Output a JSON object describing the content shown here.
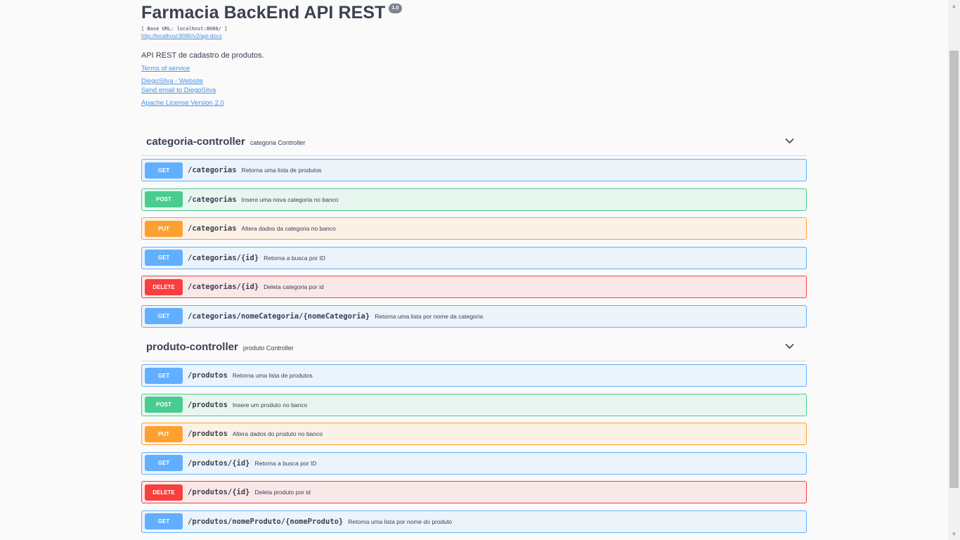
{
  "info": {
    "title": "Farmacia BackEnd API REST",
    "version": "1.0",
    "base_url": "[ Base URL: localhost:8080/ ]",
    "docs_link": "http://localhost:8080/v2/api-docs",
    "description": "API REST de cadastro de produtos.",
    "terms": "Terms of service",
    "website": "DiegoSilva - Website",
    "email": "Send email to DiegoSilva",
    "license": "Apache License Version 2.0"
  },
  "tags": [
    {
      "name": "categoria-controller",
      "description": "categoria Controller",
      "operations": [
        {
          "method": "GET",
          "path": "/categorias",
          "summary": "Retorna uma lista de produtos"
        },
        {
          "method": "POST",
          "path": "/categorias",
          "summary": "Insere uma nova categoria no banco"
        },
        {
          "method": "PUT",
          "path": "/categorias",
          "summary": "Altera dados da categoria no banco"
        },
        {
          "method": "GET",
          "path": "/categorias/{id}",
          "summary": "Retorna a busca por ID"
        },
        {
          "method": "DELETE",
          "path": "/categorias/{id}",
          "summary": "Deleta categoria por id"
        },
        {
          "method": "GET",
          "path": "/categorias/nomeCategoria/{nomeCategoria}",
          "summary": "Retorna uma lista por nome da categoria"
        }
      ]
    },
    {
      "name": "produto-controller",
      "description": "produto Controller",
      "operations": [
        {
          "method": "GET",
          "path": "/produtos",
          "summary": "Retorna uma lista de produtos"
        },
        {
          "method": "POST",
          "path": "/produtos",
          "summary": "Insere um produto no banco"
        },
        {
          "method": "PUT",
          "path": "/produtos",
          "summary": "Altera dados do produto no banco"
        },
        {
          "method": "GET",
          "path": "/produtos/{id}",
          "summary": "Retorna a busca por ID"
        },
        {
          "method": "DELETE",
          "path": "/produtos/{id}",
          "summary": "Deleta produto por id"
        },
        {
          "method": "GET",
          "path": "/produtos/nomeProduto/{nomeProduto}",
          "summary": "Retorna uma lista por nome do produto"
        }
      ]
    }
  ],
  "colors": {
    "get": "#61affe",
    "post": "#49cc90",
    "put": "#fca130",
    "delete": "#f93e3e",
    "link": "#4990e2"
  },
  "icons": {
    "collapse": "chevron-down-icon"
  }
}
